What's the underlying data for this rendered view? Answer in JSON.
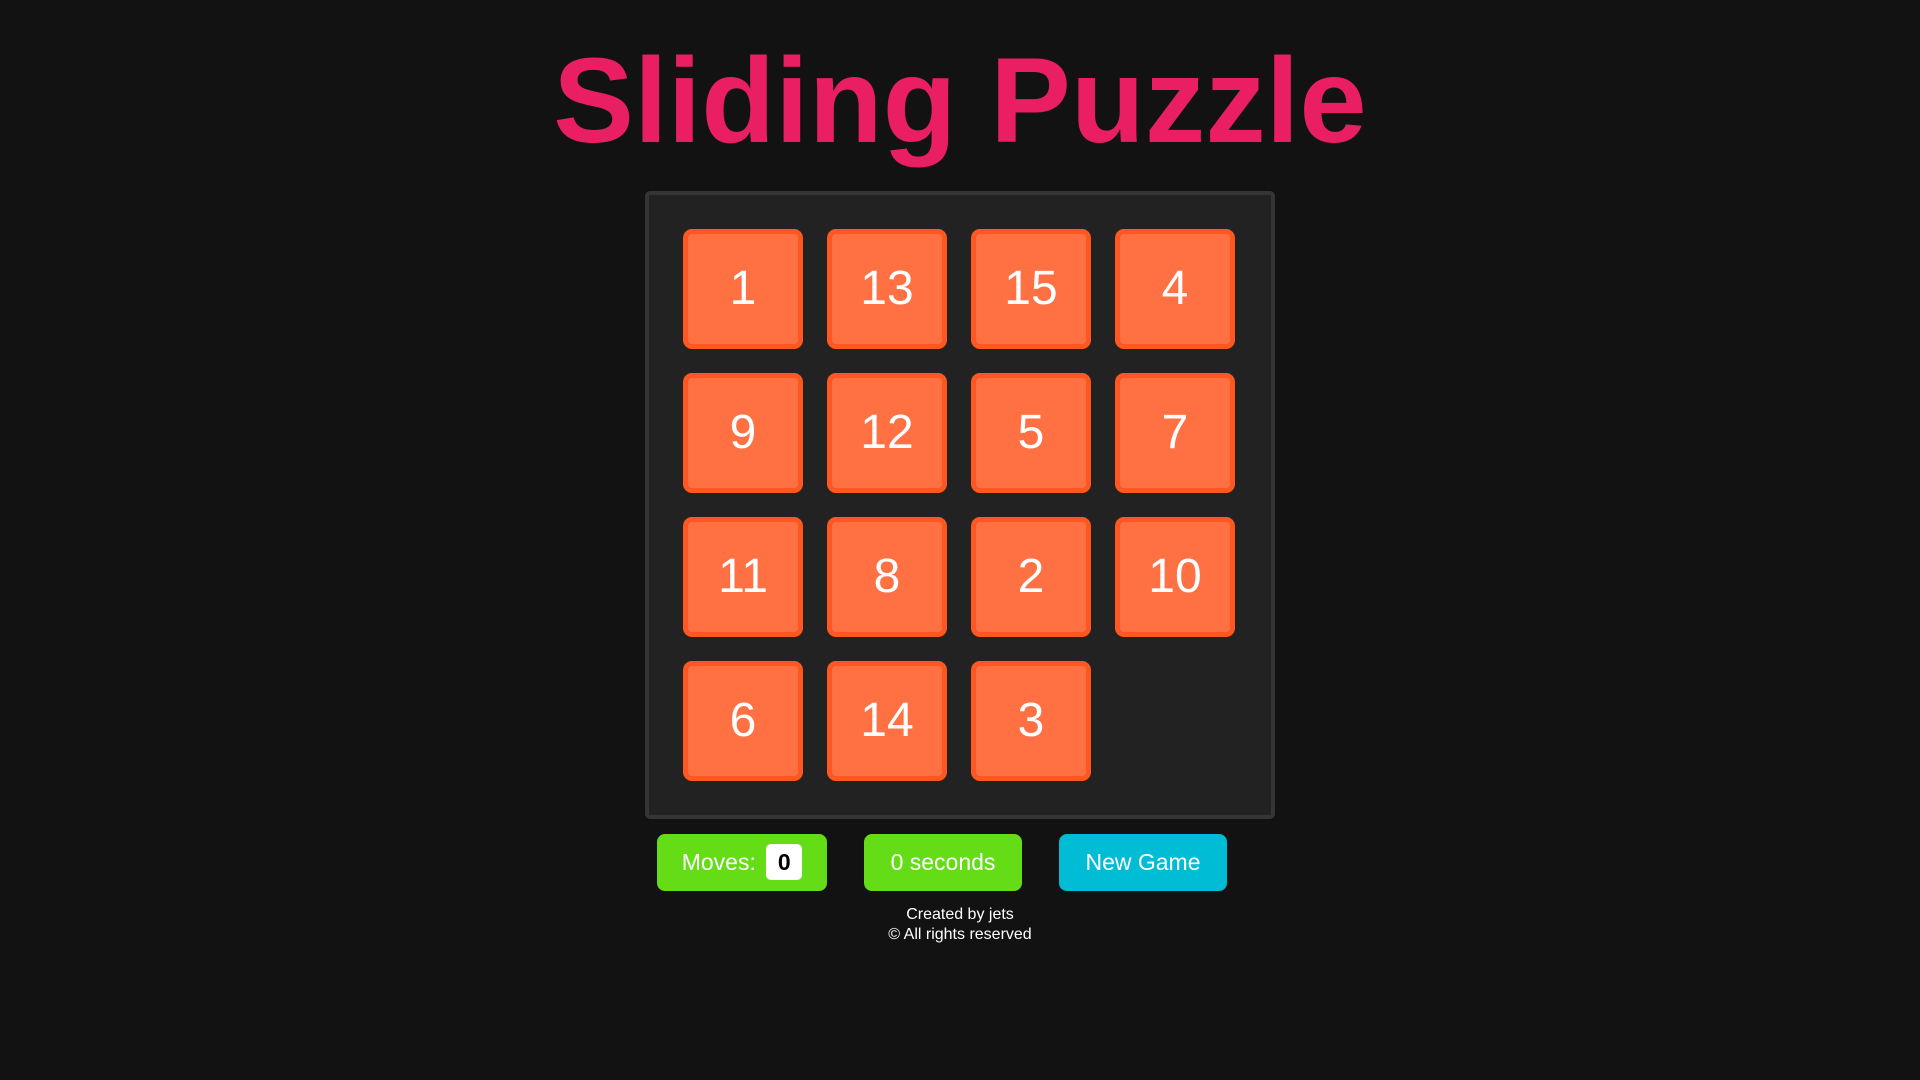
{
  "title": "Sliding Puzzle",
  "board": {
    "rows": [
      [
        "1",
        "13",
        "15",
        "4"
      ],
      [
        "9",
        "12",
        "5",
        "7"
      ],
      [
        "11",
        "8",
        "2",
        "10"
      ],
      [
        "6",
        "14",
        "3",
        null
      ]
    ]
  },
  "controls": {
    "moves_label": "Moves:",
    "moves_value": "0",
    "timer_text": "0 seconds",
    "new_game_label": "New Game"
  },
  "footer": {
    "line1": "Created by jets",
    "line2": "© All rights reserved"
  },
  "colors": {
    "background": "#121212",
    "title": "#e91e63",
    "board": "#222222",
    "tile": "#ff7043",
    "tile_border": "#ff5722",
    "moves_timer_bg": "#64dd17",
    "new_game_bg": "#00bcd4"
  }
}
